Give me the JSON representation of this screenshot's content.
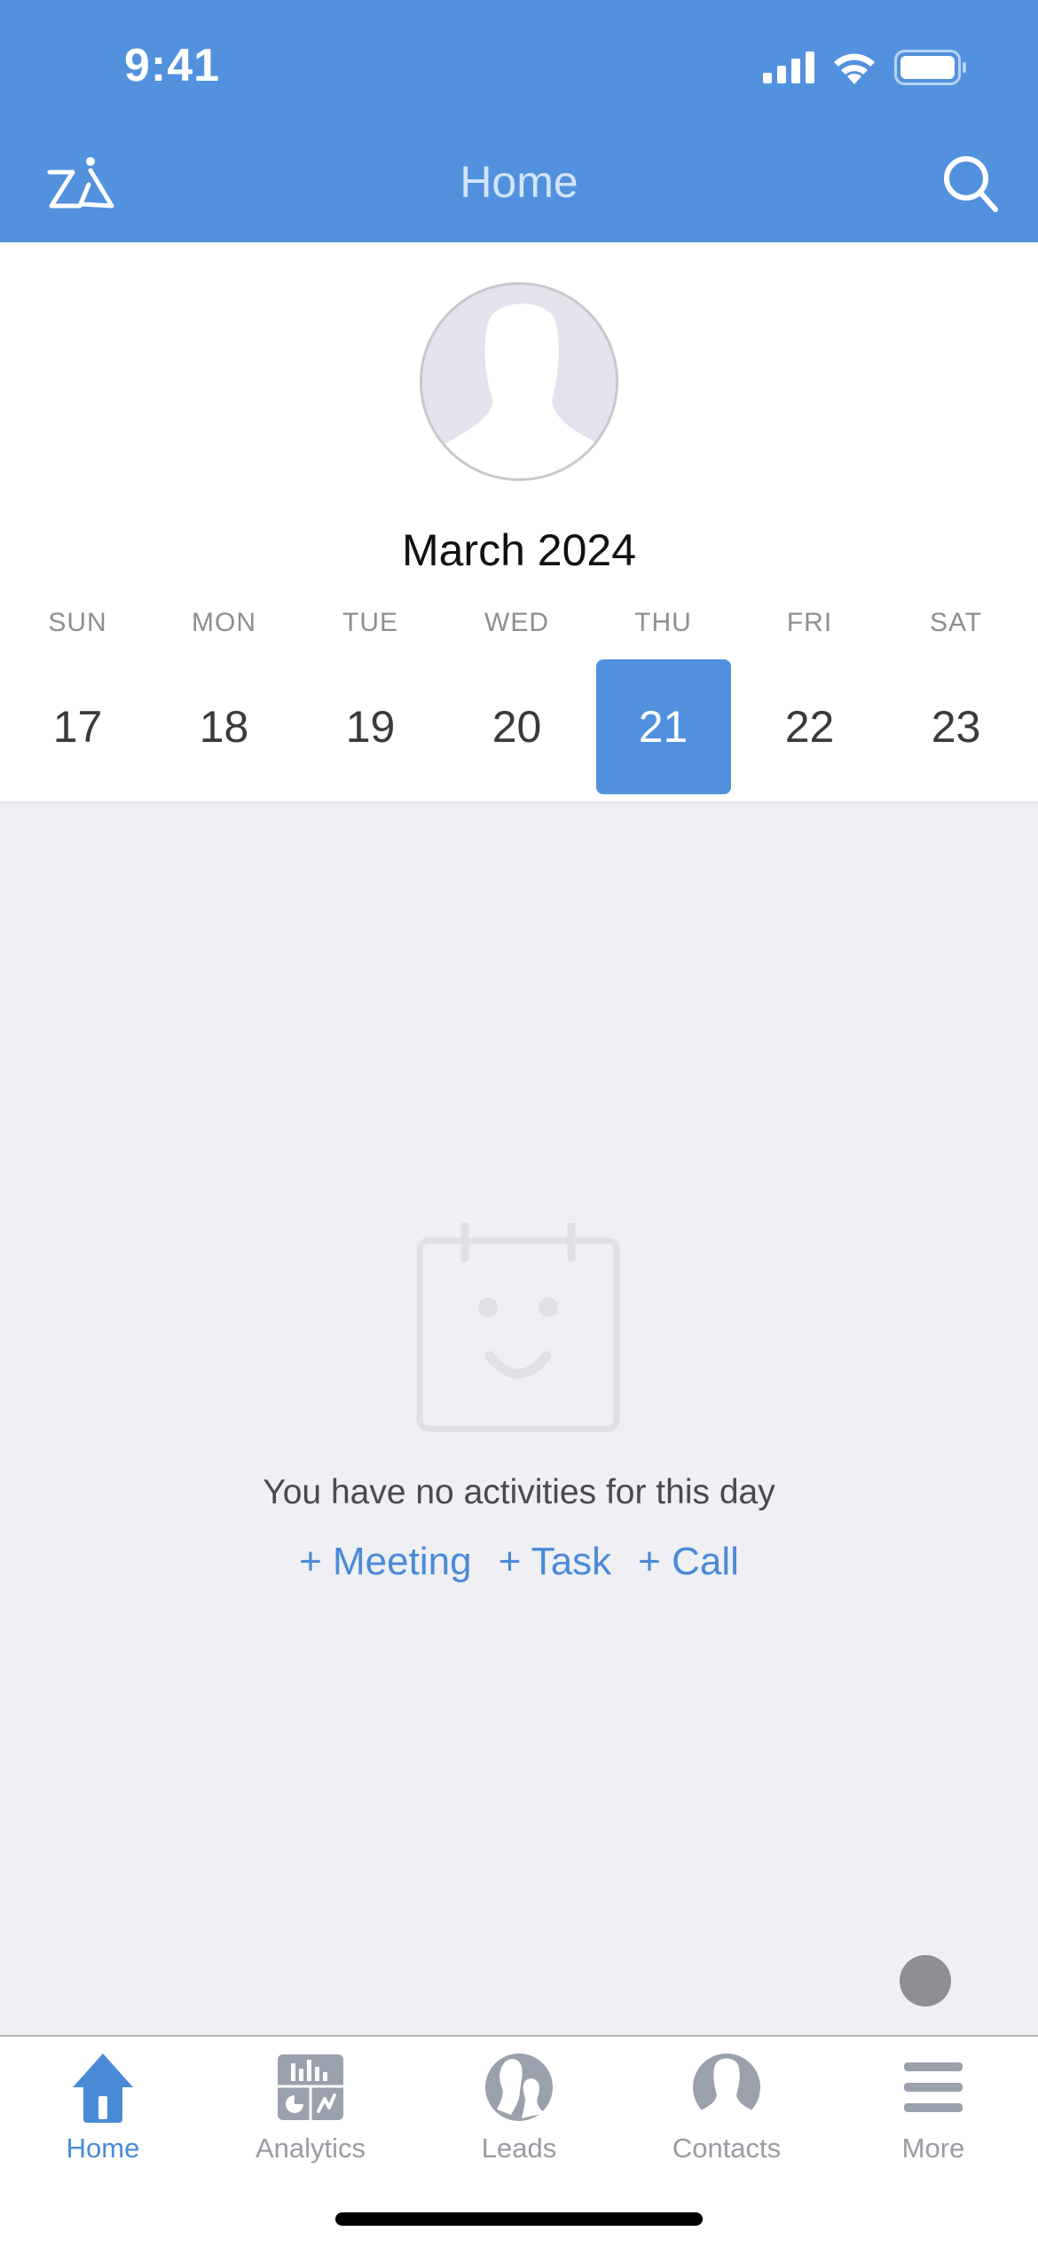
{
  "status_bar": {
    "time": "9:41"
  },
  "header": {
    "title": "Home",
    "left_icon": "zia-assistant-icon",
    "right_icon": "search-icon",
    "background_color": "#5291de"
  },
  "calendar": {
    "month_label": "March 2024",
    "weekdays": [
      "SUN",
      "MON",
      "TUE",
      "WED",
      "THU",
      "FRI",
      "SAT"
    ],
    "dates": [
      "17",
      "18",
      "19",
      "20",
      "21",
      "22",
      "23"
    ],
    "selected_date": "21",
    "accent_color": "#5291de"
  },
  "empty_state": {
    "icon": "calendar-smile-icon",
    "message": "You have no activities for this day",
    "actions": [
      "+ Meeting",
      "+ Task",
      "+ Call"
    ]
  },
  "tabbar": {
    "items": [
      {
        "label": "Home",
        "icon": "home-icon",
        "active": true
      },
      {
        "label": "Analytics",
        "icon": "analytics-icon",
        "active": false
      },
      {
        "label": "Leads",
        "icon": "leads-icon",
        "active": false
      },
      {
        "label": "Contacts",
        "icon": "contacts-icon",
        "active": false
      },
      {
        "label": "More",
        "icon": "menu-icon",
        "active": false
      }
    ]
  }
}
